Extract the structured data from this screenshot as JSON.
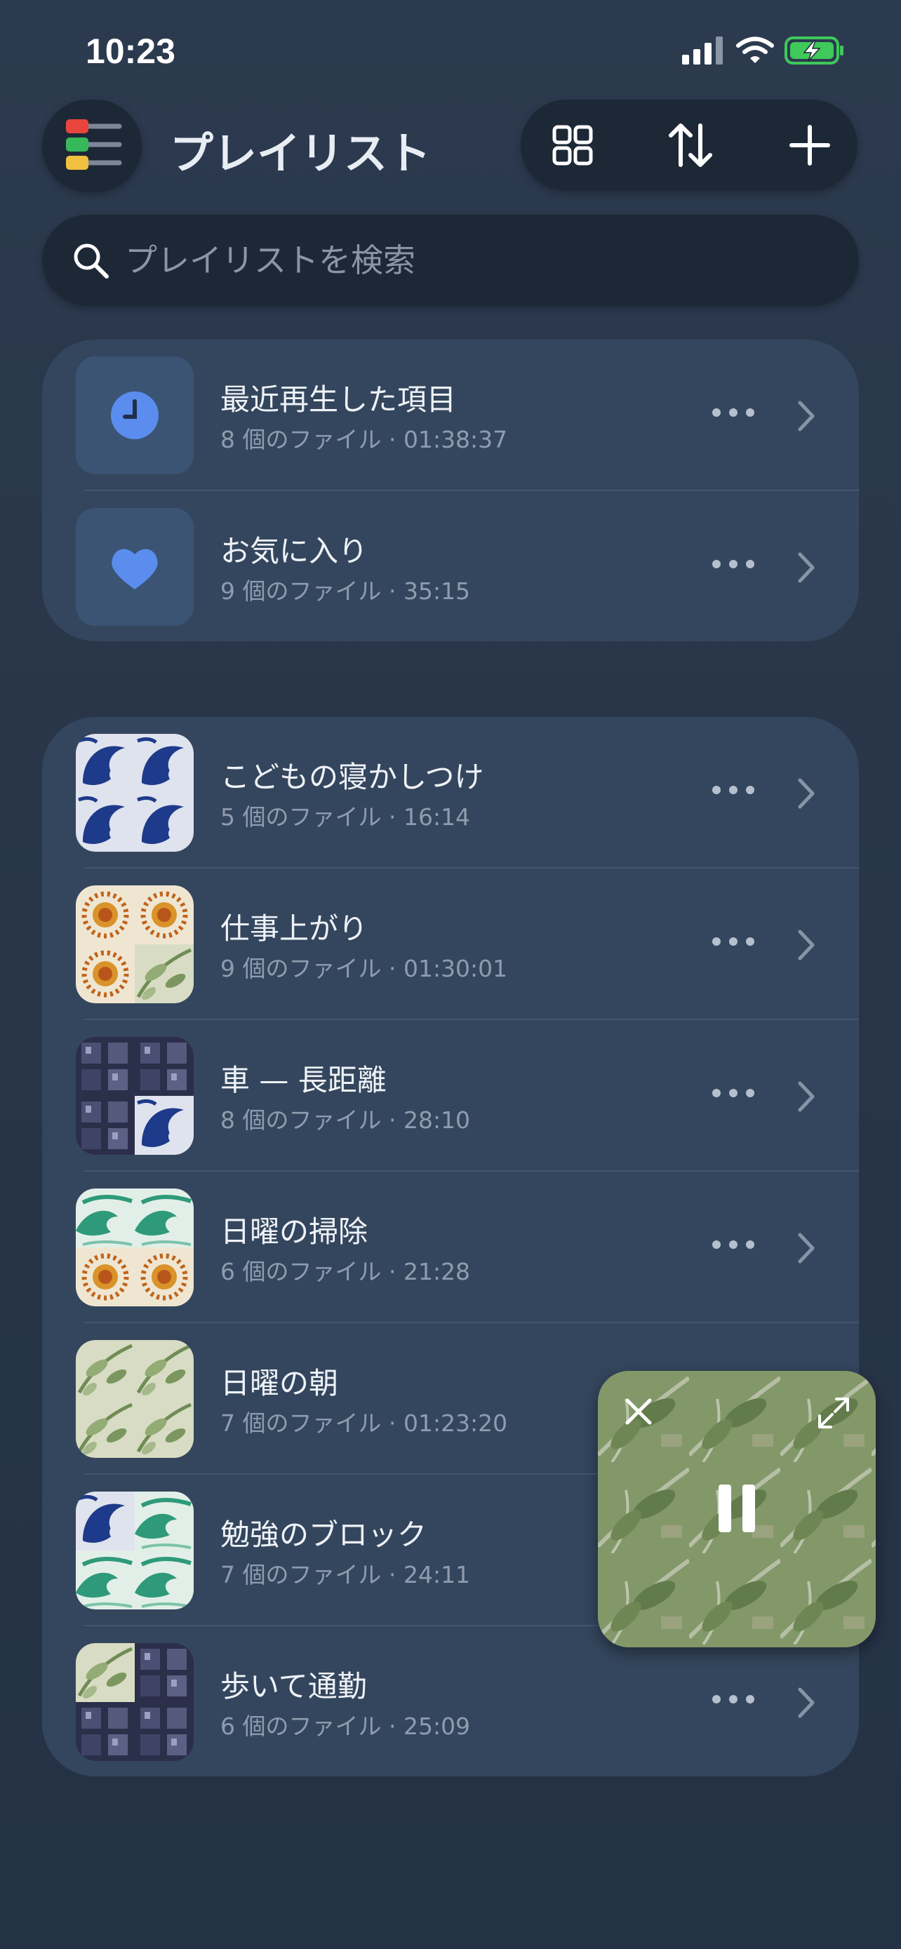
{
  "status_bar": {
    "time": "10:23"
  },
  "header": {
    "title": "プレイリスト",
    "menu_icon": "playlist-menu-icon",
    "toolbar": [
      "grid-view-icon",
      "sort-icon",
      "add-icon"
    ]
  },
  "search": {
    "placeholder": "プレイリストを検索",
    "value": ""
  },
  "special_playlists": [
    {
      "title": "最近再生した項目",
      "subtitle": "8 個のファイル · 01:38:37",
      "icon": "clock-icon"
    },
    {
      "title": "お気に入り",
      "subtitle": "9 個のファイル · 35:15",
      "icon": "heart-icon"
    }
  ],
  "playlists": [
    {
      "title": "こどもの寝かしつけ",
      "subtitle": "5 個のファイル · 16:14"
    },
    {
      "title": "仕事上がり",
      "subtitle": "9 個のファイル · 01:30:01"
    },
    {
      "title": "車 — 長距離",
      "subtitle": "8 個のファイル · 28:10"
    },
    {
      "title": "日曜の掃除",
      "subtitle": "6 個のファイル · 21:28"
    },
    {
      "title": "日曜の朝",
      "subtitle": "7 個のファイル · 01:23:20"
    },
    {
      "title": "勉強のブロック",
      "subtitle": "7 個のファイル · 24:11"
    },
    {
      "title": "歩いて通勤",
      "subtitle": "6 個のファイル · 25:09"
    }
  ],
  "colors": {
    "background": "#283548",
    "card": "#34465d",
    "accent_blue": "#5b8def",
    "battery_green": "#3ec95a"
  }
}
